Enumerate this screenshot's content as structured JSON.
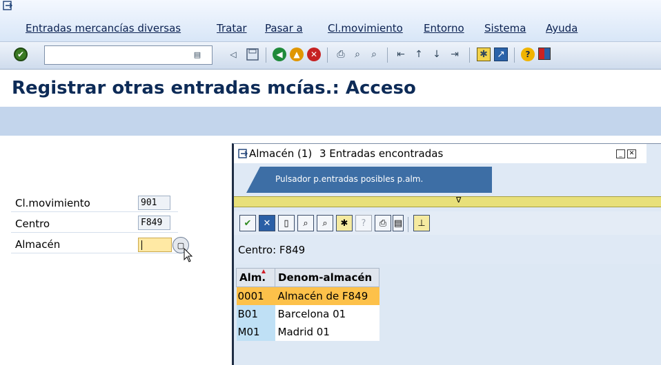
{
  "menu": {
    "items": [
      "Entradas mercancías diversas",
      "Tratar",
      "Pasar a",
      "Cl.movimiento",
      "Entorno",
      "Sistema",
      "Ayuda"
    ]
  },
  "toolbar": {
    "command_value": "",
    "icons": [
      "enter-icon",
      "command-dropdown-icon",
      "back-arrow-icon",
      "save-icon",
      "back-icon",
      "exit-icon",
      "cancel-icon",
      "print-icon",
      "find-icon",
      "find-next-icon",
      "first-page-icon",
      "previous-page-icon",
      "next-page-icon",
      "last-page-icon",
      "create-session-icon",
      "shortcut-icon",
      "help-icon",
      "customize-layout-icon"
    ]
  },
  "page": {
    "title": "Registrar otras entradas mcías.: Acceso"
  },
  "form": {
    "movement_label": "Cl.movimiento",
    "movement_value": "901",
    "plant_label": "Centro",
    "plant_value": "F849",
    "storage_label": "Almacén",
    "storage_value": ""
  },
  "popup": {
    "title": "Almacén (1)",
    "count_text": "3 Entradas encontradas",
    "tab_label": "Pulsador p.entradas posibles p.alm.",
    "collapse_glyph": "∇",
    "filter_text": "Centro: F849",
    "table": {
      "headers": [
        "Alm.",
        "Denom-almacén"
      ],
      "rows": [
        [
          "0001",
          "Almacén de F849"
        ],
        [
          "B01",
          "Barcelona 01"
        ],
        [
          "M01",
          "Madrid 01"
        ]
      ],
      "selected_index": 0
    }
  },
  "colors": {
    "title": "#0d2b57",
    "blue_band": "#c3d5ec",
    "popup_tab": "#3d6ea5",
    "selected_row": "#fdc14a",
    "key_cell": "#bfe0f5",
    "input_focus": "#ffe9a4"
  }
}
